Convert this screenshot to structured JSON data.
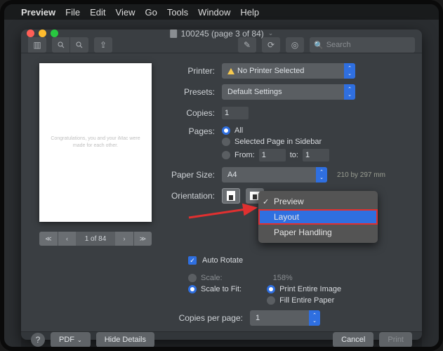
{
  "menubar": {
    "app": "Preview",
    "items": [
      "File",
      "Edit",
      "View",
      "Go",
      "Tools",
      "Window",
      "Help"
    ]
  },
  "window": {
    "title": "100245 (page 3 of 84)"
  },
  "toolbar": {
    "search_placeholder": "Search"
  },
  "preview": {
    "page_message": "Congratulations, you and your iMac were made for each other.",
    "pager_label": "1 of 84"
  },
  "print": {
    "labels": {
      "printer": "Printer:",
      "presets": "Presets:",
      "copies": "Copies:",
      "pages": "Pages:",
      "paper_size": "Paper Size:",
      "orientation": "Orientation:",
      "auto_rotate": "Auto Rotate",
      "scale": "Scale:",
      "scale_to_fit": "Scale to Fit:",
      "copies_per_page": "Copies per page:"
    },
    "printer_value": "No Printer Selected",
    "presets_value": "Default Settings",
    "copies_value": "1",
    "pages_all": "All",
    "pages_selected": "Selected Page in Sidebar",
    "pages_from": "From:",
    "from_value": "1",
    "pages_to": "to:",
    "to_value": "1",
    "paper_size_value": "A4",
    "paper_dims": "210 by 297 mm",
    "menu": {
      "preview": "Preview",
      "layout": "Layout",
      "paper_handling": "Paper Handling"
    },
    "scale_value": "158%",
    "fit_print_entire": "Print Entire Image",
    "fit_fill_paper": "Fill Entire Paper",
    "copies_per_page_value": "1"
  },
  "footer": {
    "pdf": "PDF",
    "hide_details": "Hide Details",
    "cancel": "Cancel",
    "print": "Print"
  }
}
